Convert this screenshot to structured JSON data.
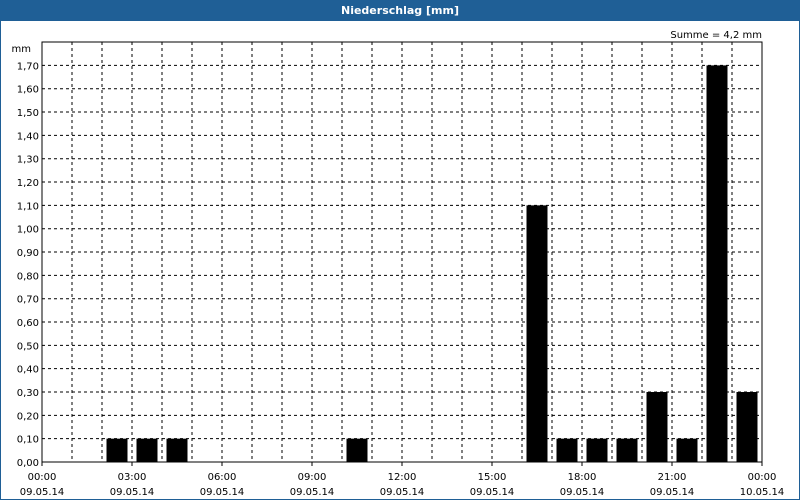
{
  "window": {
    "title": "Niederschlag [mm]"
  },
  "chart_data": {
    "type": "bar",
    "title": "Niederschlag [mm]",
    "ylabel": "mm",
    "annotation": "Summe = 4,2 mm",
    "ylim": [
      0,
      1.8
    ],
    "y_ticks": [
      "0,00",
      "0,10",
      "0,20",
      "0,30",
      "0,40",
      "0,50",
      "0,60",
      "0,70",
      "0,80",
      "0,90",
      "1,00",
      "1,10",
      "1,20",
      "1,30",
      "1,40",
      "1,50",
      "1,60",
      "1,70"
    ],
    "x_ticks": [
      {
        "time": "00:00",
        "date": "09.05.14"
      },
      {
        "time": "03:00",
        "date": "09.05.14"
      },
      {
        "time": "06:00",
        "date": "09.05.14"
      },
      {
        "time": "09:00",
        "date": "09.05.14"
      },
      {
        "time": "12:00",
        "date": "09.05.14"
      },
      {
        "time": "15:00",
        "date": "09.05.14"
      },
      {
        "time": "18:00",
        "date": "09.05.14"
      },
      {
        "time": "21:00",
        "date": "09.05.14"
      },
      {
        "time": "00:00",
        "date": "10.05.14"
      }
    ],
    "x_range_hours": [
      0,
      24
    ],
    "bar_width_hours": 0.7,
    "bars": [
      {
        "hour": 2.5,
        "value": 0.1
      },
      {
        "hour": 3.5,
        "value": 0.1
      },
      {
        "hour": 4.5,
        "value": 0.1
      },
      {
        "hour": 10.5,
        "value": 0.1
      },
      {
        "hour": 16.5,
        "value": 1.1
      },
      {
        "hour": 17.5,
        "value": 0.1
      },
      {
        "hour": 18.5,
        "value": 0.1
      },
      {
        "hour": 19.5,
        "value": 0.1
      },
      {
        "hour": 20.5,
        "value": 0.3
      },
      {
        "hour": 21.5,
        "value": 0.1
      },
      {
        "hour": 22.5,
        "value": 1.7
      },
      {
        "hour": 23.5,
        "value": 0.3
      }
    ],
    "colors": {
      "bar": "#000000",
      "grid": "#000000",
      "title_bg": "#1f5f96"
    }
  }
}
